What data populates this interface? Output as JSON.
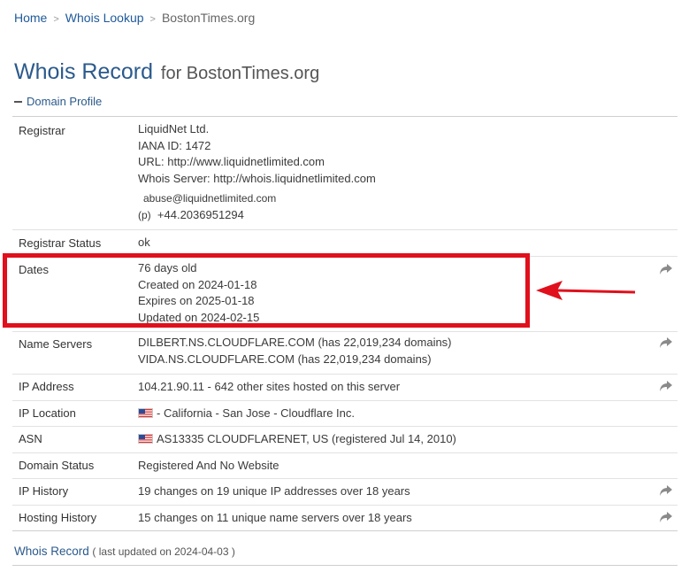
{
  "breadcrumb": {
    "home": "Home",
    "whois_lookup": "Whois Lookup",
    "current": "BostonTimes.org",
    "sep": ">"
  },
  "title": {
    "main": "Whois Record",
    "rest": "for BostonTimes.org"
  },
  "section": {
    "label": "Domain Profile"
  },
  "rows": {
    "registrar": {
      "label": "Registrar",
      "name": "LiquidNet Ltd.",
      "iana": "IANA ID: 1472",
      "url": "URL: http://www.liquidnetlimited.com",
      "whois_server": "Whois Server: http://whois.liquidnetlimited.com",
      "email": "abuse@liquidnetlimited.com",
      "phone_prefix": "(p)",
      "phone": "+44.2036951294"
    },
    "registrar_status": {
      "label": "Registrar Status",
      "value": "ok"
    },
    "dates": {
      "label": "Dates",
      "age": "76 days old",
      "created": "Created on 2024-01-18",
      "expires": "Expires on 2025-01-18",
      "updated": "Updated on 2024-02-15"
    },
    "name_servers": {
      "label": "Name Servers",
      "ns1": "DILBERT.NS.CLOUDFLARE.COM (has 22,019,234 domains)",
      "ns2": "VIDA.NS.CLOUDFLARE.COM (has 22,019,234 domains)"
    },
    "ip_address": {
      "label": "IP Address",
      "value": "104.21.90.11 - 642 other sites hosted on this server"
    },
    "ip_location": {
      "label": "IP Location",
      "value": "- California - San Jose - Cloudflare Inc."
    },
    "asn": {
      "label": "ASN",
      "value": "AS13335 CLOUDFLARENET, US (registered Jul 14, 2010)"
    },
    "domain_status": {
      "label": "Domain Status",
      "value": "Registered And No Website"
    },
    "ip_history": {
      "label": "IP History",
      "value": "19 changes on 19 unique IP addresses over 18 years"
    },
    "hosting_history": {
      "label": "Hosting History",
      "value": "15 changes on 11 unique name servers over 18 years"
    }
  },
  "footer": {
    "link": "Whois Record",
    "note": "( last updated on 2024-04-03 )"
  },
  "colors": {
    "link": "#1f5a9a",
    "title": "#2b5a8c",
    "highlight": "#e0101c"
  },
  "icons": {
    "share": "share-arrow-icon",
    "flag": "us-flag-icon"
  }
}
